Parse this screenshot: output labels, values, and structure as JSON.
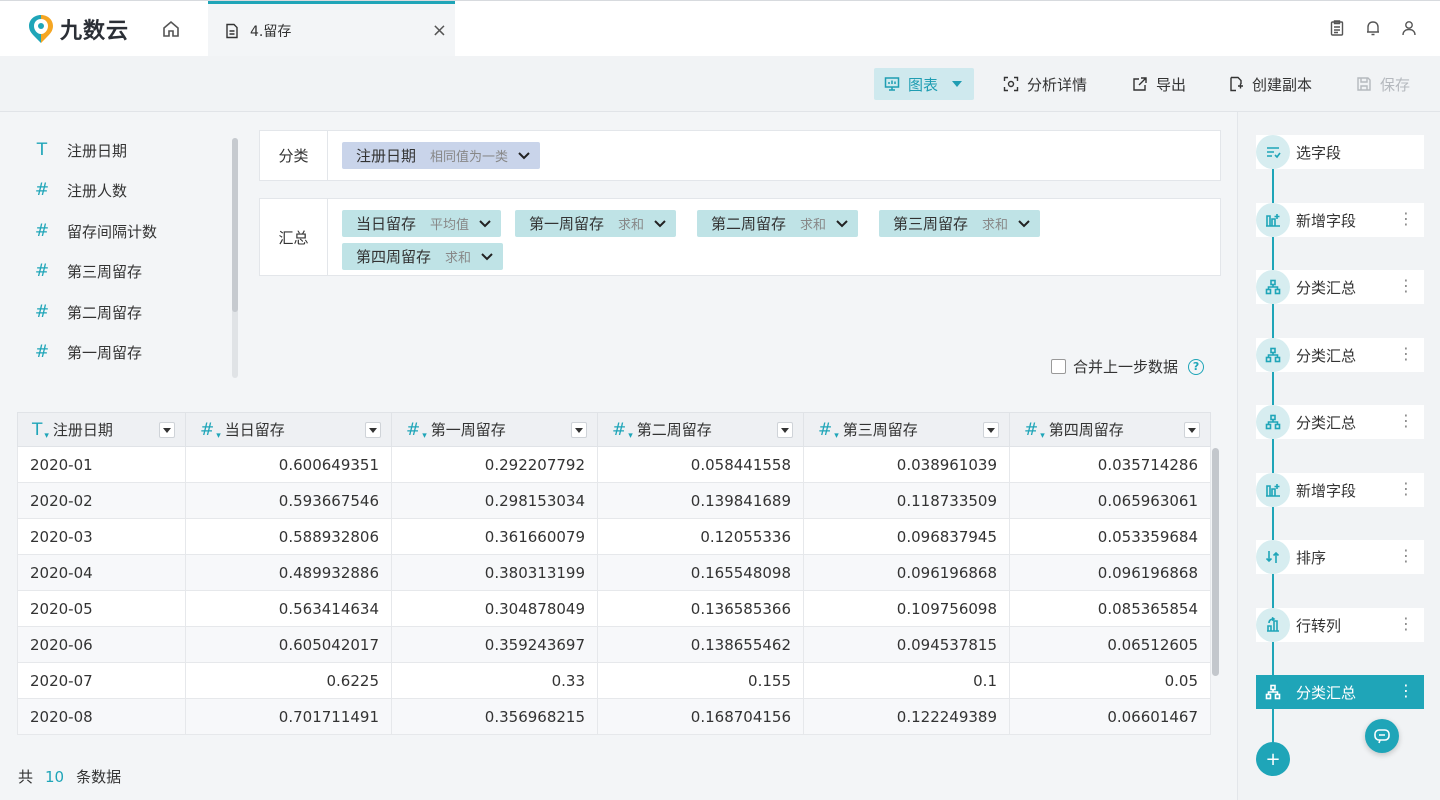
{
  "app": {
    "logo_text": "九数云",
    "tab_title": "4.留存",
    "tab_close": "×"
  },
  "toolbar": {
    "chart": "图表",
    "detail": "分析详情",
    "export": "导出",
    "copy": "创建副本",
    "save": "保存"
  },
  "fields": [
    {
      "icon": "T",
      "label": "注册日期"
    },
    {
      "icon": "#",
      "label": "注册人数"
    },
    {
      "icon": "#",
      "label": "留存间隔计数"
    },
    {
      "icon": "#",
      "label": "第三周留存"
    },
    {
      "icon": "#",
      "label": "第二周留存"
    },
    {
      "icon": "#",
      "label": "第一周留存"
    }
  ],
  "category": {
    "label": "分类",
    "chip": {
      "name": "注册日期",
      "agg": "相同值为一类"
    }
  },
  "summary": {
    "label": "汇总",
    "chips": [
      {
        "name": "当日留存",
        "agg": "平均值"
      },
      {
        "name": "第一周留存",
        "agg": "求和"
      },
      {
        "name": "第二周留存",
        "agg": "求和"
      },
      {
        "name": "第三周留存",
        "agg": "求和"
      },
      {
        "name": "第四周留存",
        "agg": "求和"
      }
    ]
  },
  "merge": {
    "label": "合并上一步数据",
    "help": "?"
  },
  "table": {
    "columns": [
      {
        "icon": "T",
        "name": "注册日期"
      },
      {
        "icon": "#",
        "name": "当日留存"
      },
      {
        "icon": "#",
        "name": "第一周留存"
      },
      {
        "icon": "#",
        "name": "第二周留存"
      },
      {
        "icon": "#",
        "name": "第三周留存"
      },
      {
        "icon": "#",
        "name": "第四周留存"
      }
    ],
    "rows": [
      [
        "2020-01",
        "0.600649351",
        "0.292207792",
        "0.058441558",
        "0.038961039",
        "0.035714286"
      ],
      [
        "2020-02",
        "0.593667546",
        "0.298153034",
        "0.139841689",
        "0.118733509",
        "0.065963061"
      ],
      [
        "2020-03",
        "0.588932806",
        "0.361660079",
        "0.12055336",
        "0.096837945",
        "0.053359684"
      ],
      [
        "2020-04",
        "0.489932886",
        "0.380313199",
        "0.165548098",
        "0.096196868",
        "0.096196868"
      ],
      [
        "2020-05",
        "0.563414634",
        "0.304878049",
        "0.136585366",
        "0.109756098",
        "0.085365854"
      ],
      [
        "2020-06",
        "0.605042017",
        "0.359243697",
        "0.138655462",
        "0.094537815",
        "0.06512605"
      ],
      [
        "2020-07",
        "0.6225",
        "0.33",
        "0.155",
        "0.1",
        "0.05"
      ],
      [
        "2020-08",
        "0.701711491",
        "0.356968215",
        "0.168704156",
        "0.122249389",
        "0.06601467"
      ]
    ]
  },
  "footer": {
    "prefix": "共",
    "count": "10",
    "suffix": "条数据"
  },
  "steps": [
    {
      "label": "选字段",
      "icon": "select-fields-icon",
      "more": ""
    },
    {
      "label": "新增字段",
      "icon": "add-field-icon",
      "more": "⋮"
    },
    {
      "label": "分类汇总",
      "icon": "group-summary-icon",
      "more": "⋮"
    },
    {
      "label": "分类汇总",
      "icon": "group-summary-icon",
      "more": "⋮"
    },
    {
      "label": "分类汇总",
      "icon": "group-summary-icon",
      "more": "⋮"
    },
    {
      "label": "新增字段",
      "icon": "add-field-icon",
      "more": "⋮"
    },
    {
      "label": "排序",
      "icon": "sort-icon",
      "more": "⋮"
    },
    {
      "label": "行转列",
      "icon": "pivot-icon",
      "more": "⋮"
    },
    {
      "label": "分类汇总",
      "icon": "group-summary-icon",
      "more": "⋮"
    }
  ],
  "add_step": "+",
  "colors": {
    "accent": "#1fa5b8",
    "chip_blue": "#c9d4ea",
    "chip_teal": "#bfe3e6"
  }
}
